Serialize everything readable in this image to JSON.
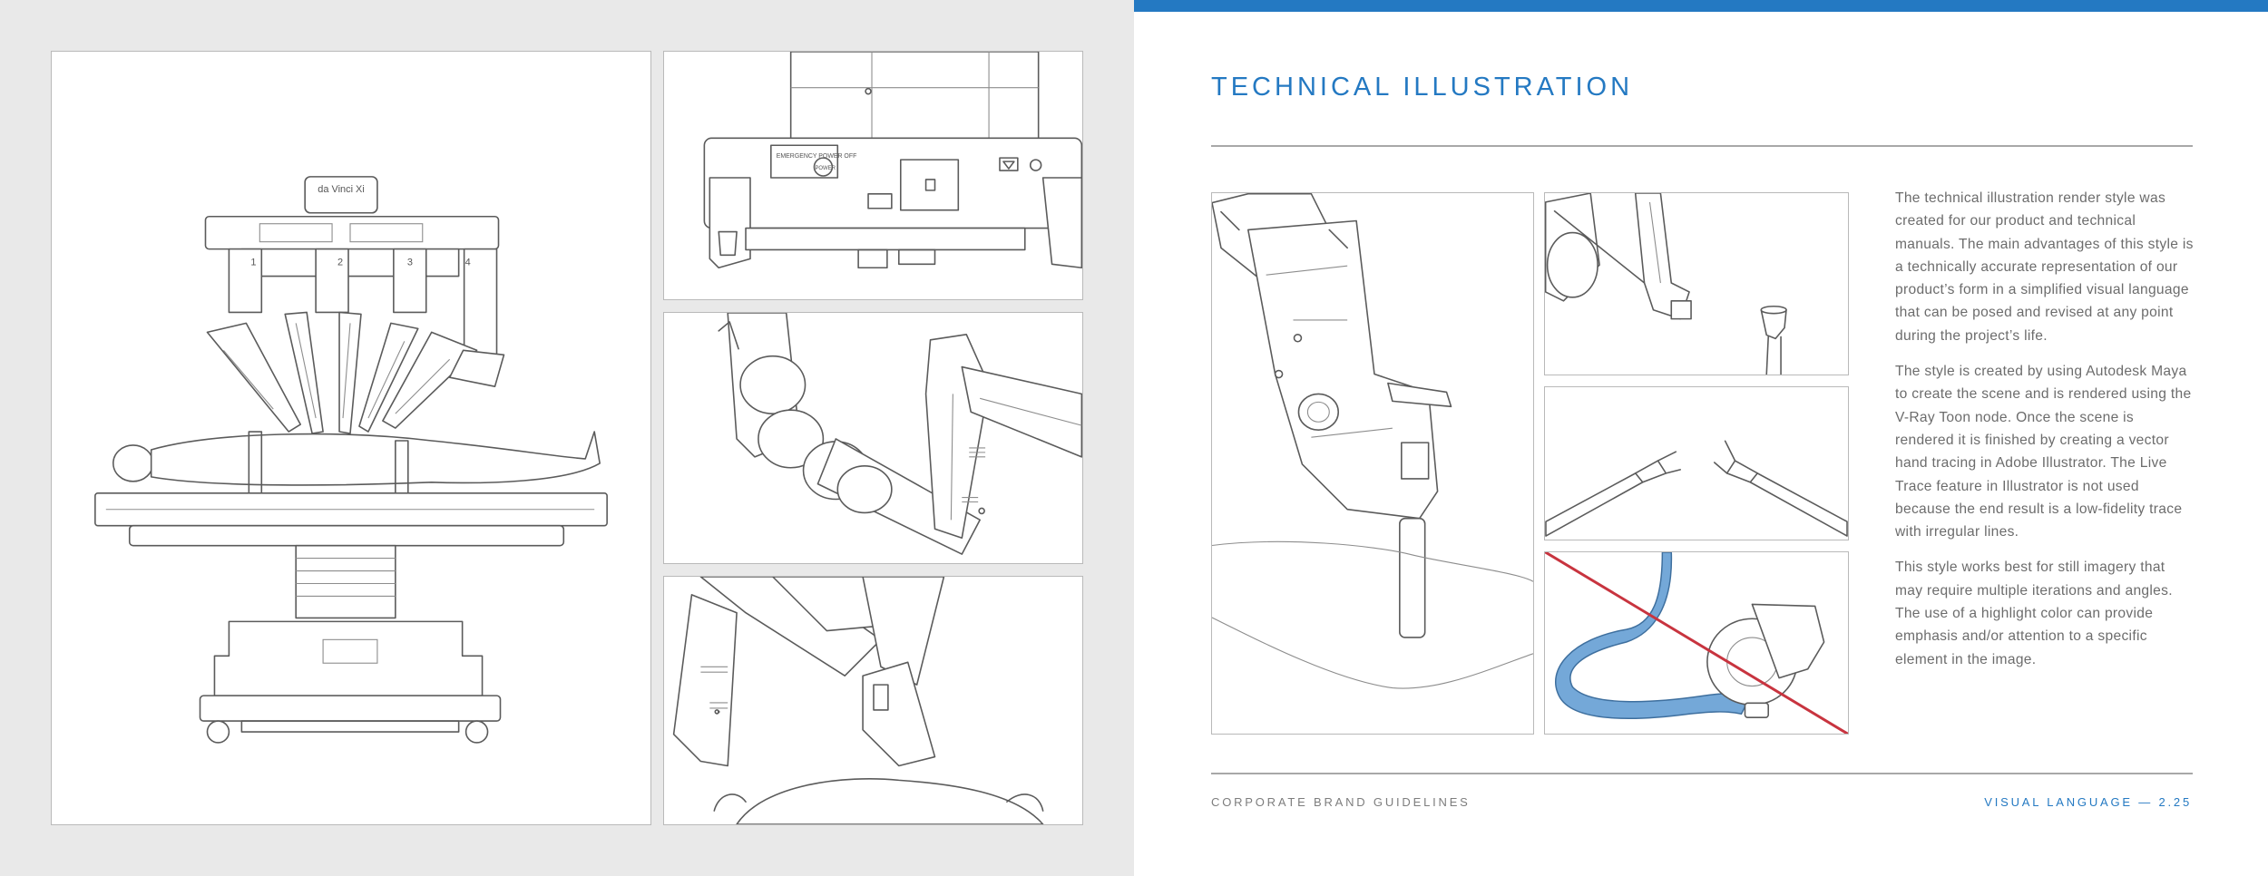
{
  "header": {
    "title": "TECHNICAL ILLUSTRATION"
  },
  "body": {
    "paragraphs": [
      "The technical illustration render style was created for our product and technical manuals. The main advantages of this style is a technically accurate representation of our product’s form in a simplified visual language that can be posed and revised at any point during the project’s life.",
      "The style is created by using Autodesk Maya to create the scene and is rendered using the V-Ray Toon node. Once the scene is rendered it is finished by creating a vector hand tracing in Adobe Illustrator. The Live Trace feature in Illustrator is not used because the end result is a low-fidelity trace with irregular lines.",
      "This style works best for still imagery that may require multiple iterations and angles. The use of a highlight color can provide emphasis and/or attention to a specific element in the image."
    ]
  },
  "footer": {
    "left": "CORPORATE BRAND GUIDELINES",
    "right": "VISUAL LANGUAGE — 2.25"
  },
  "illustration": {
    "logo_text": "da Vinci Xi",
    "arm_numbers": [
      "1",
      "2",
      "3",
      "4"
    ],
    "panel_text": "EMERGENCY POWER OFF",
    "power_label": "POWER"
  },
  "colors": {
    "accent": "#2479c2",
    "highlight": "#74a8d8",
    "strike": "#c8343f",
    "line": "#5b5b5b"
  },
  "icons": [
    "surgical-robot-icon",
    "robotic-arm-icon",
    "instrument-icon",
    "prohibited-line-icon"
  ]
}
